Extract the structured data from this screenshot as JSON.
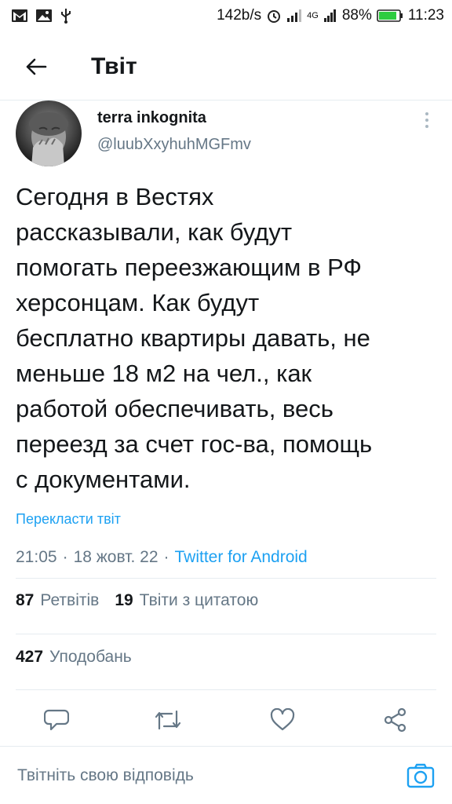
{
  "status_bar": {
    "net_speed": "142b/s",
    "network_type": "4G",
    "battery_percent": "88%",
    "battery_level": 0.88,
    "time": "11:23"
  },
  "header": {
    "title": "Твіт"
  },
  "tweet": {
    "author_name": "terra inkognita",
    "author_handle": "@luubXxyhuhMGFmv",
    "text": "Сегодня в Вестях\nрассказывали, как будут\nпомогать переезжающим в РФ\nхерсонцам. Как будут\nбесплатно квартиры давать, не\nменьше 18 м2 на чел., как\nработой обеспечивать, весь\nпереезд за счет гос-ва, помощь\nс документами.",
    "translate_label": "Перекласти твіт",
    "time": "21:05",
    "separator": "·",
    "date": "18 жовт. 22",
    "client": "Twitter for Android"
  },
  "stats": {
    "retweets_count": "87",
    "retweets_label": "Ретвітів",
    "quotes_count": "19",
    "quotes_label": "Твіти з цитатою",
    "likes_count": "427",
    "likes_label": "Уподобань"
  },
  "reply": {
    "placeholder": "Твітніть свою відповідь"
  },
  "colors": {
    "accent": "#1da1f2",
    "secondary_text": "#657786",
    "icon": "#657786",
    "divider": "#e6ecf0"
  },
  "icons": {
    "back": "arrow-left-icon",
    "more": "more-vertical-icon",
    "reply": "comment-icon",
    "retweet": "retweet-icon",
    "like": "heart-icon",
    "share": "share-icon",
    "camera": "camera-icon"
  }
}
